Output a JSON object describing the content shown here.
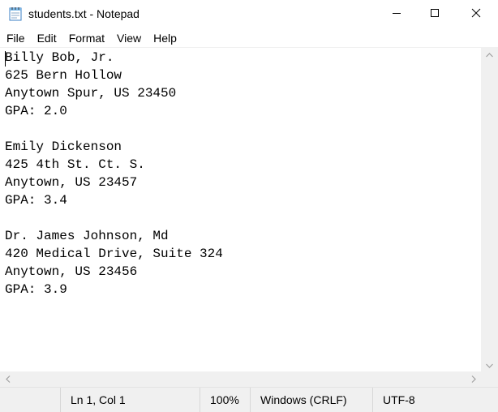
{
  "window": {
    "title": "students.txt - Notepad"
  },
  "menu": {
    "items": [
      "File",
      "Edit",
      "Format",
      "View",
      "Help"
    ]
  },
  "editor": {
    "lines": [
      "Billy Bob, Jr.",
      "625 Bern Hollow",
      "Anytown Spur, US 23450",
      "GPA: 2.0",
      "",
      "Emily Dickenson",
      "425 4th St. Ct. S.",
      "Anytown, US 23457",
      "GPA: 3.4",
      "",
      "Dr. James Johnson, Md",
      "420 Medical Drive, Suite 324",
      "Anytown, US 23456",
      "GPA: 3.9"
    ]
  },
  "status": {
    "position": "Ln 1, Col 1",
    "zoom": "100%",
    "line_endings": "Windows (CRLF)",
    "encoding": "UTF-8"
  },
  "icons": {
    "app": "notepad-icon",
    "minimize": "minimize-icon",
    "maximize": "maximize-icon",
    "close": "close-icon"
  },
  "colors": {
    "chrome": "#f0f0f0",
    "text": "#000000",
    "background": "#ffffff"
  }
}
